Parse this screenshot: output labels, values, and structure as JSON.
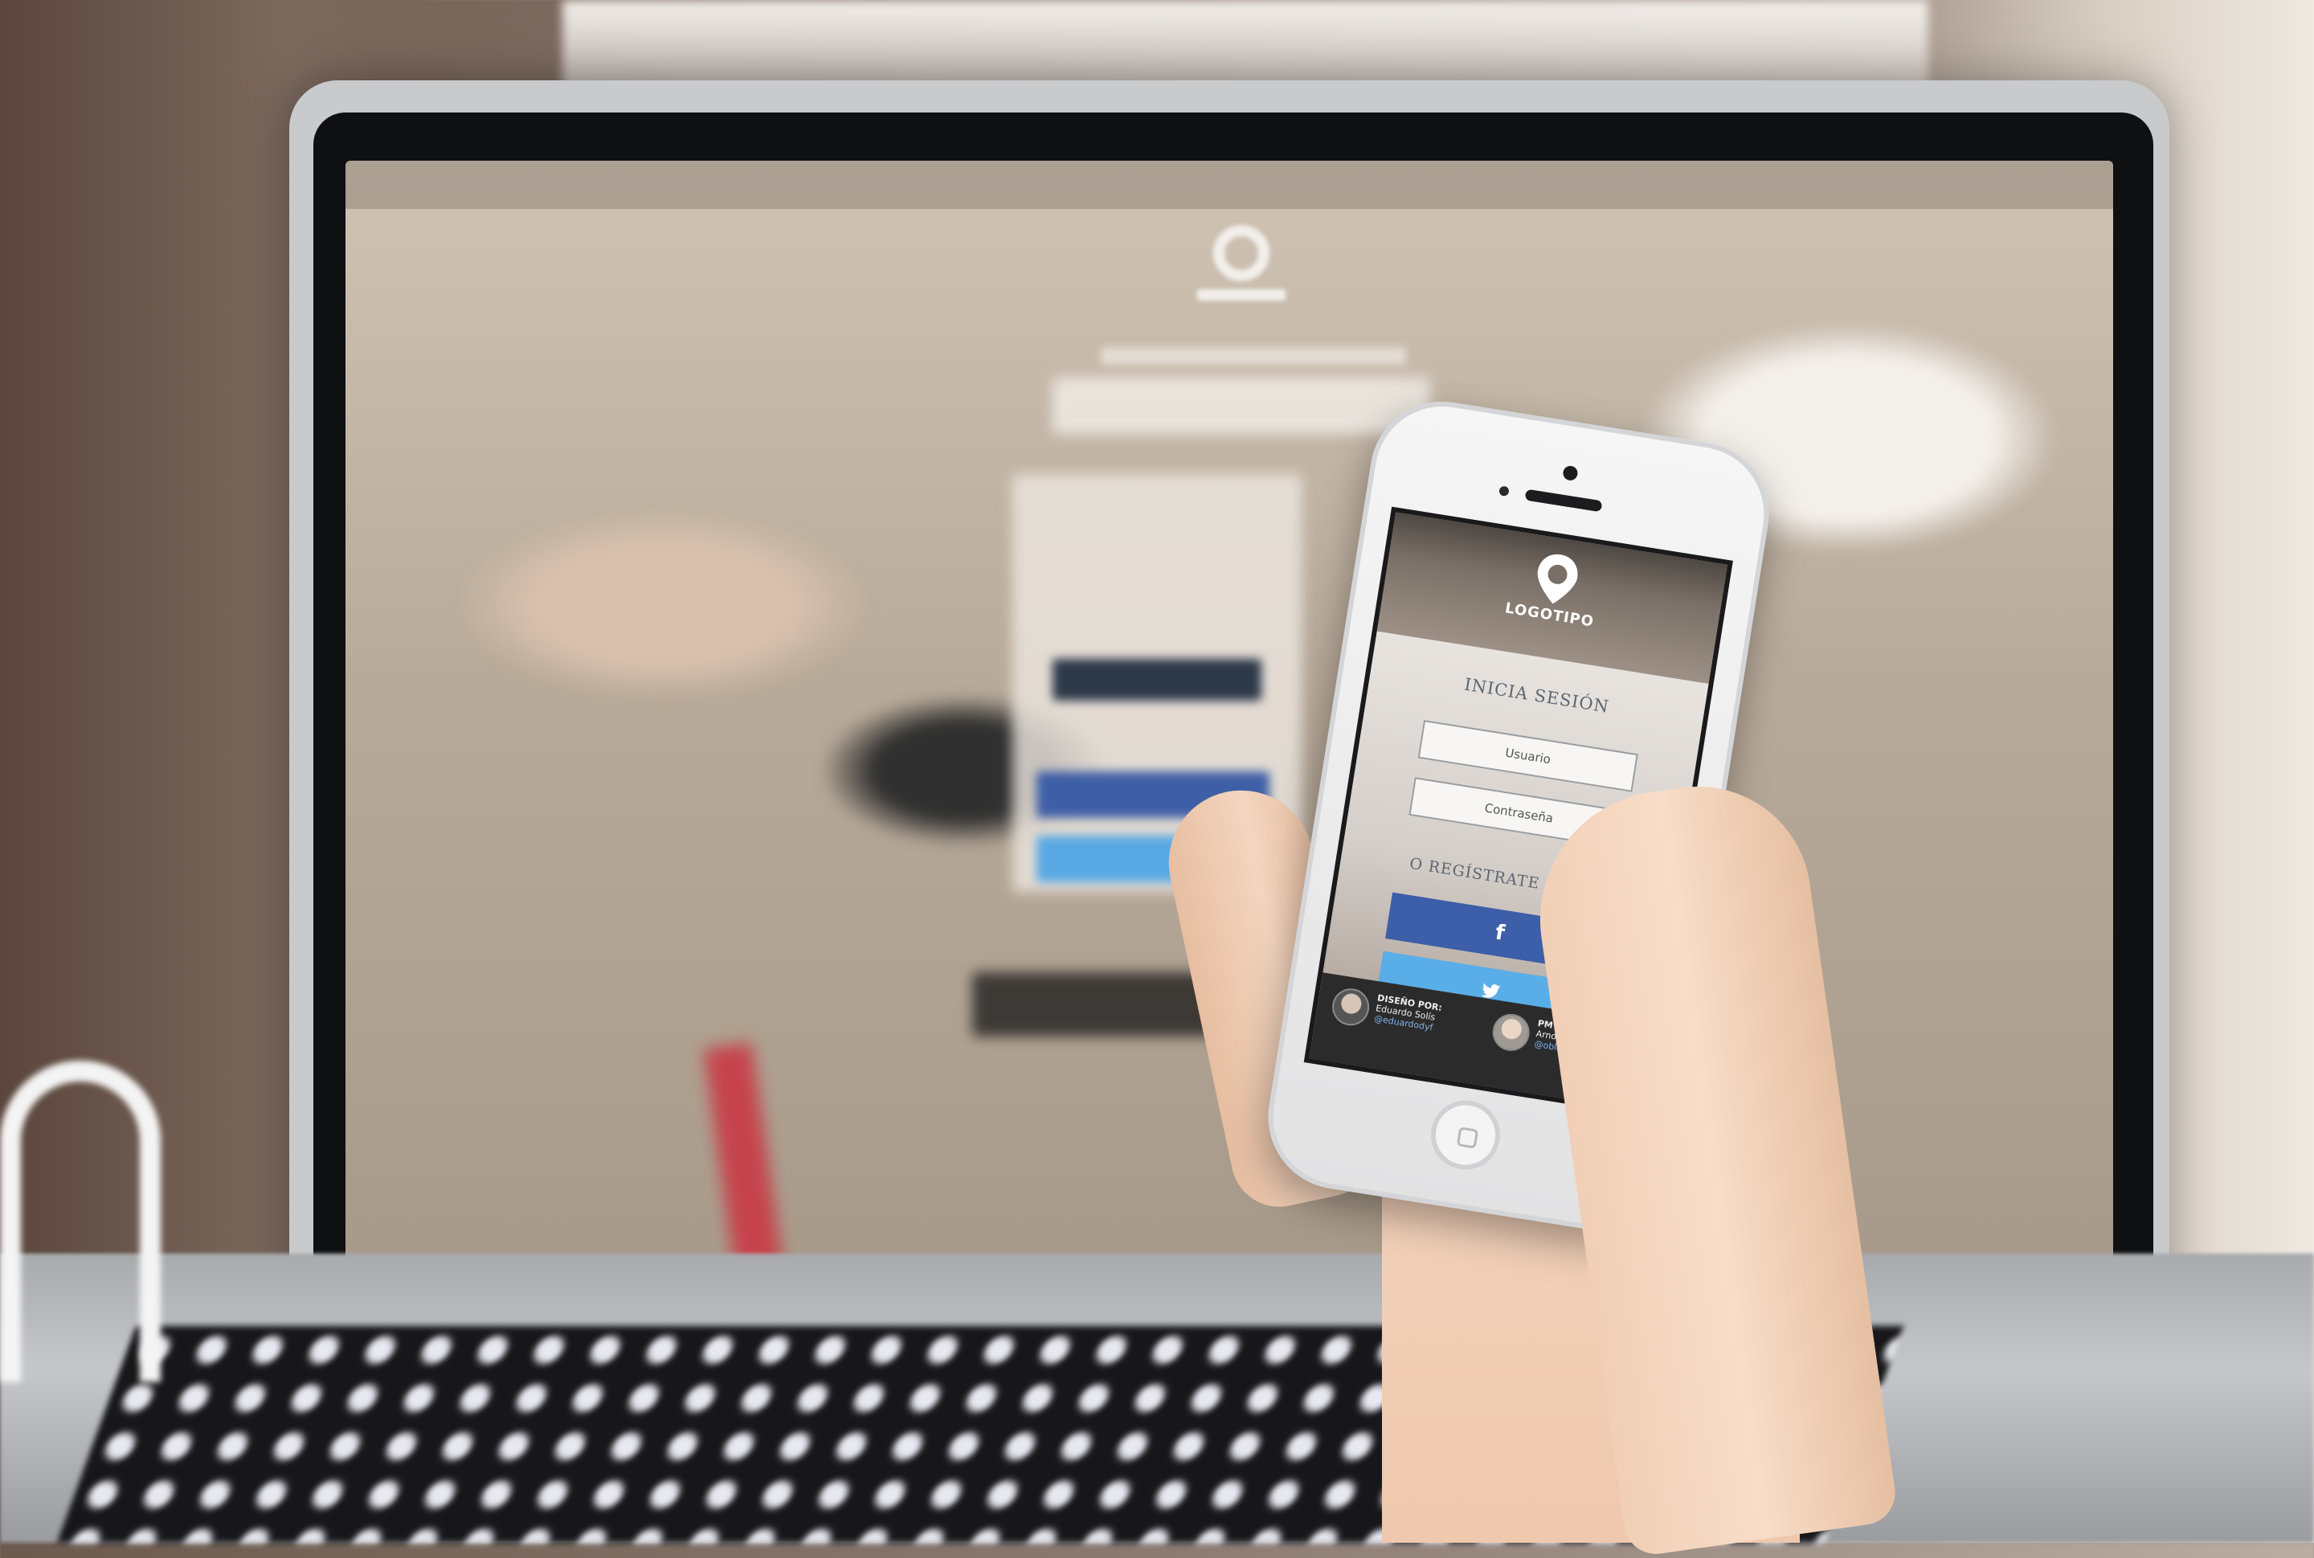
{
  "login": {
    "logo_text": "LOGOTIPO",
    "title": "INICIA SESIÓN",
    "username_placeholder": "Usuario",
    "password_placeholder": "Contraseña",
    "register_title": "O REGÍSTRATE DESDE",
    "facebook_glyph": "f",
    "twitter_glyph": "twitter-icon"
  },
  "credits": [
    {
      "role": "DISEÑO POR:",
      "name": "Eduardo Solís",
      "handle": "@eduardodyf"
    },
    {
      "role": "PM & BACKEND:",
      "name": "Arnoldo Blanco",
      "handle": "@oblancomorales"
    }
  ],
  "colors": {
    "facebook": "#3d5ea8",
    "twitter": "#5aaee8",
    "heading": "#5c6672",
    "footer": "#2c2b2b"
  }
}
